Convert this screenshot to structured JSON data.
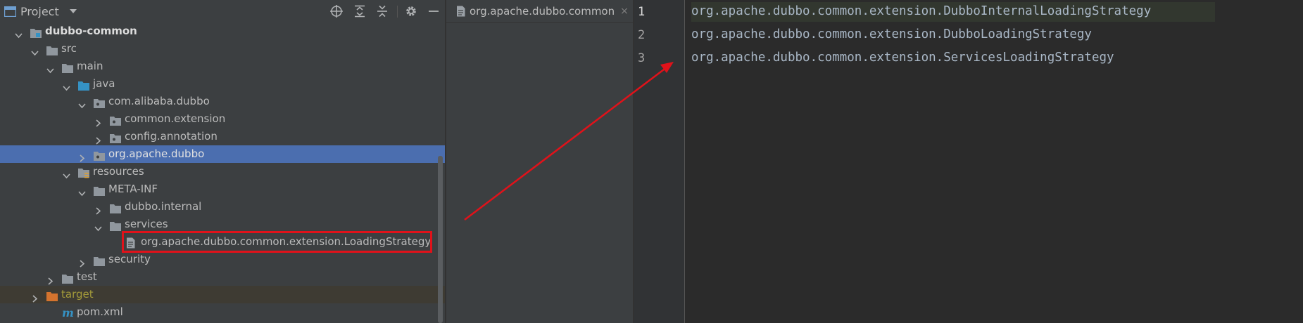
{
  "project_panel": {
    "title": "Project",
    "tree": [
      {
        "label": "dubbo-common",
        "expanded": true,
        "icon": "module-folder-icon"
      },
      {
        "label": "src",
        "expanded": true,
        "icon": "folder-icon"
      },
      {
        "label": "main",
        "expanded": true,
        "icon": "folder-icon"
      },
      {
        "label": "java",
        "expanded": true,
        "icon": "source-folder-icon"
      },
      {
        "label": "com.alibaba.dubbo",
        "expanded": true,
        "icon": "package-icon"
      },
      {
        "label": "common.extension",
        "expanded": false,
        "icon": "package-icon"
      },
      {
        "label": "config.annotation",
        "expanded": false,
        "icon": "package-icon"
      },
      {
        "label": "org.apache.dubbo",
        "expanded": false,
        "icon": "package-icon",
        "selected": true
      },
      {
        "label": "resources",
        "expanded": true,
        "icon": "resources-folder-icon"
      },
      {
        "label": "META-INF",
        "expanded": true,
        "icon": "folder-icon"
      },
      {
        "label": "dubbo.internal",
        "expanded": false,
        "icon": "folder-icon"
      },
      {
        "label": "services",
        "expanded": true,
        "icon": "folder-icon"
      },
      {
        "label": "org.apache.dubbo.common.extension.LoadingStrategy",
        "icon": "text-file-icon",
        "highlighted": true
      },
      {
        "label": "security",
        "expanded": false,
        "icon": "folder-icon"
      },
      {
        "label": "test",
        "expanded": false,
        "icon": "folder-icon"
      },
      {
        "label": "target",
        "expanded": false,
        "icon": "excluded-folder-icon"
      },
      {
        "label": "pom.xml",
        "icon": "maven-icon"
      }
    ]
  },
  "editor_tab": {
    "label": "org.apache.dubbo.common",
    "close": "×"
  },
  "editor": {
    "line_numbers": [
      "1",
      "2",
      "3"
    ],
    "lines": [
      "org.apache.dubbo.common.extension.DubboInternalLoadingStrategy",
      "org.apache.dubbo.common.extension.DubboLoadingStrategy",
      "org.apache.dubbo.common.extension.ServicesLoadingStrategy"
    ]
  },
  "colors": {
    "selection": "#4b6eaf",
    "annotation_red": "#e0121a",
    "code_text": "#a9b7c6",
    "panel_bg": "#3c3f41",
    "editor_bg": "#2b2b2b"
  }
}
